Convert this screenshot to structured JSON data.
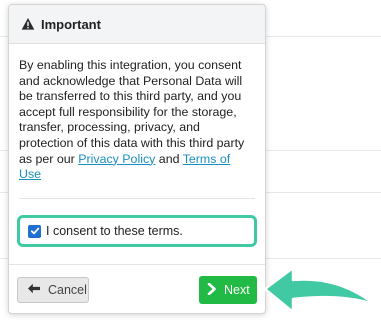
{
  "modal": {
    "title": "Important",
    "body_text": "By enabling this integration, you consent and acknowledge that Personal Data will be transferred to this third party, and you accept full responsibility for the storage, transfer, processing, privacy, and protection of this data with this third party as per our ",
    "privacy_link": "Privacy Policy",
    "conjunction": " and ",
    "terms_link": "Terms of Use",
    "consent": {
      "label": "I consent to these terms.",
      "checked": true
    },
    "buttons": {
      "cancel_label": "Cancel",
      "next_label": "Next"
    }
  },
  "icons": {
    "header": "warning-triangle-icon",
    "cancel": "arrow-left-icon",
    "next": "chevron-right-icon",
    "pointer": "pointing-arrow-icon"
  },
  "colors": {
    "accent_highlight": "#40c9a2",
    "next_button": "#21ba45",
    "link": "#1a8fbf",
    "checkbox": "#1f6fd1"
  }
}
